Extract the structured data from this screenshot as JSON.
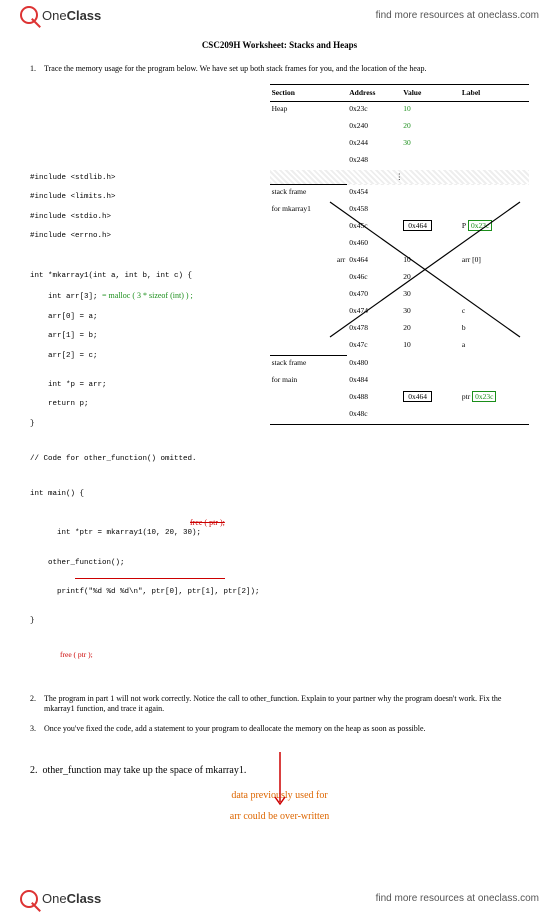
{
  "brand": {
    "name_light": "One",
    "name_bold": "Class",
    "tagline": "find more resources at oneclass.com"
  },
  "title": "CSC209H Worksheet: Stacks and Heaps",
  "q1": {
    "num": "1.",
    "text": "Trace the memory usage for the program below. We have set up both stack frames for you, and the location of the heap."
  },
  "code": {
    "includes": [
      "#include <stdlib.h>",
      "#include <limits.h>",
      "#include <stdio.h>",
      "#include <errno.h>"
    ],
    "sig": "int *mkarray1(int a, int b, int c) {",
    "decl": "    int arr[3];",
    "a0": "    arr[0] = a;",
    "a1": "    arr[1] = b;",
    "a2": "    arr[2] = c;",
    "blank1": "",
    "pdecl": "    int *p = arr;",
    "ret": "    return p;",
    "close1": "}",
    "comment": "// Code for other_function() omitted.",
    "mainopen": "int main() {",
    "blank2": "",
    "call": "    int *ptr = mkarray1(10, 20, 30);",
    "other": "    other_function();",
    "printf": "    printf(\"%d %d %d\\n\", ptr[0], ptr[1], ptr[2]);",
    "close2": "}"
  },
  "hw_code": {
    "malloc": "= malloc ( 3 * sizeof (int) ) ;",
    "free1": "free ( ptr );",
    "free2": "free ( ptr );"
  },
  "table": {
    "headers": [
      "Section",
      "Address",
      "Value",
      "Label"
    ],
    "heap": {
      "label": "Heap",
      "rows": [
        "0x23c",
        "0x240",
        "0x244",
        "0x248"
      ]
    },
    "heap_hw": [
      "10",
      "20",
      "30"
    ],
    "frame1": {
      "label_a": "stack frame",
      "label_b": "for mkarray1",
      "rows": [
        "0x454",
        "0x458",
        "0x45c",
        "0x460",
        "0x464",
        "0x46c",
        "0x470",
        "0x474",
        "0x478",
        "0x47c"
      ]
    },
    "frame2": {
      "label_a": "stack frame",
      "label_b": "for main",
      "rows": [
        "0x480",
        "0x484",
        "0x488",
        "0x48c"
      ]
    },
    "hw": {
      "p_val": "0x464",
      "p_lbl": "P",
      "arr0_hw": "0x23c",
      "arr_lbl_a": "arr",
      "arr_lbl_b": "arr [0]",
      "r464": "10",
      "r46c": "20",
      "r470": "30",
      "r474": "30",
      "r474b": "c",
      "r478": "20",
      "r478b": "b",
      "r47c": "10",
      "r47cb": "a",
      "ptr_val": "0x464",
      "ptr_lbl": "ptr",
      "ptr_hw": "0x23c"
    }
  },
  "q2": {
    "num": "2.",
    "text": "The program in part 1 will not work correctly. Notice the call to other_function. Explain to your partner why the program doesn't work. Fix the mkarray1 function, and trace it again."
  },
  "q3": {
    "num": "3.",
    "text": "Once you've fixed the code, add a statement to your program to deallocate the memory on the heap as soon as possible."
  },
  "hw_bottom": {
    "a2_num": "2.",
    "a2": "other_function may take up the space of mkarray1.",
    "a3a": "data previously used for",
    "a3b": "arr could be over-written"
  }
}
